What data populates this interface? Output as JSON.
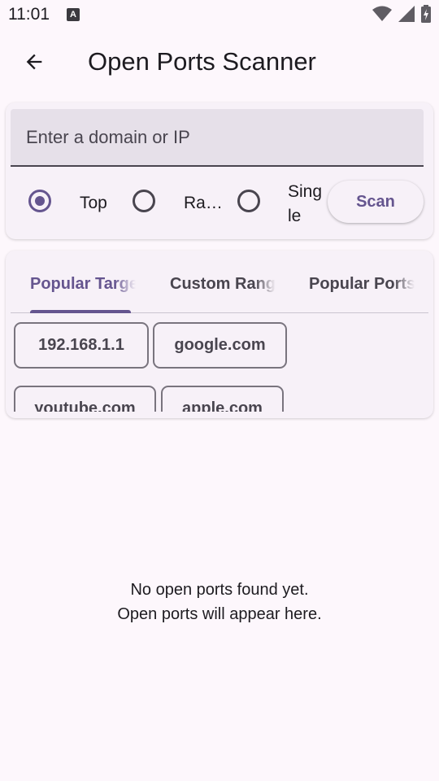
{
  "status_bar": {
    "time": "11:01",
    "notification_icon": "A"
  },
  "app_bar": {
    "back_icon": "arrow-back-icon",
    "title": "Open Ports Scanner"
  },
  "input_card": {
    "placeholder": "Enter a domain or IP",
    "value": "",
    "scan_modes": [
      {
        "label": "Top",
        "selected": true
      },
      {
        "label": "Ra…",
        "selected": false
      },
      {
        "label_line1": "Sing",
        "label_line2": "le",
        "selected": false
      }
    ],
    "scan_button": "Scan"
  },
  "tabs_card": {
    "tabs": [
      {
        "label": "Popular Targets",
        "active": true
      },
      {
        "label": "Custom Ranges",
        "active": false
      },
      {
        "label": "Popular Ports",
        "active": false
      }
    ],
    "chips": [
      "192.168.1.1",
      "google.com",
      "youtube.com",
      "apple.com"
    ]
  },
  "empty_state": {
    "line1": "No open ports found yet.",
    "line2": "Open ports will appear here."
  },
  "colors": {
    "primary": "#65558f",
    "background": "#fdf7fc",
    "card": "#f7f1f8"
  }
}
